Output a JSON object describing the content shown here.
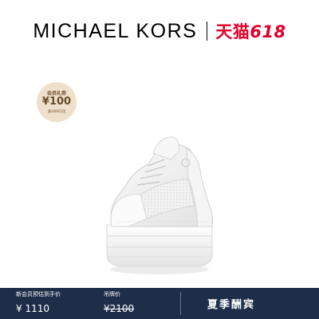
{
  "header": {
    "brand": "MICHAEL KORS",
    "platform_text": "天猫",
    "platform_num": "618",
    "platform_color": "#e1002a"
  },
  "coupon": {
    "title": "会员礼券",
    "amount": "¥100",
    "note": "满1000可用"
  },
  "product_image": {
    "icon": "white-platform-sneaker"
  },
  "price_bar": {
    "bg_color": "#1e2e49",
    "member_label": "新会员预估到手价",
    "member_price": "¥ 1110",
    "tag_label": "吊牌价",
    "tag_price": "¥2100",
    "promo": "夏季酬宾"
  }
}
